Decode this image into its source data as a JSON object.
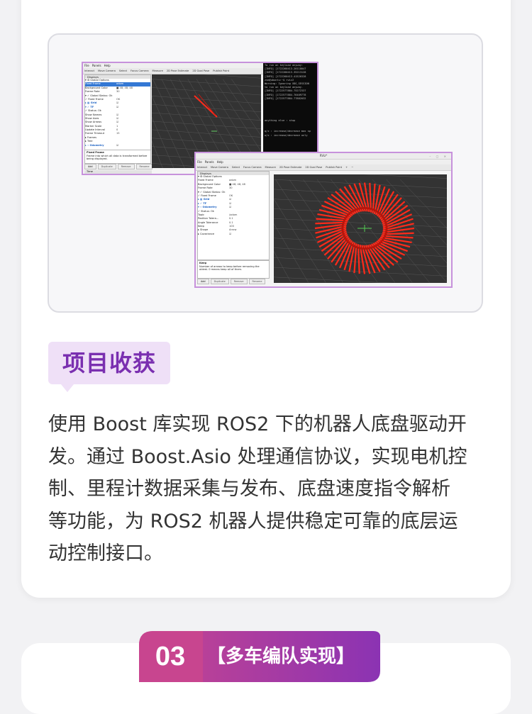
{
  "colors": {
    "page_bg": "#f2f2f4",
    "card_bg": "#ffffff",
    "tag_bg": "#efe0f7",
    "tag_text": "#7a2fb0",
    "badge_left": "#c8458f",
    "badge_right": "#8b33b3",
    "rviz_viewport": "#333333",
    "arrow_red": "#ff2a1a"
  },
  "screenshot": {
    "window1": {
      "menu": [
        "File",
        "Panels",
        "Help"
      ],
      "toolbar": [
        "Interact",
        "Move Camera",
        "Select",
        "Focus Camera",
        "Measure",
        "2D Pose Estimate",
        "2D Goal Pose",
        "Publish Point"
      ],
      "displays_title": "Displays",
      "rows": [
        {
          "k": "▾ ⚙ Global Options",
          "v": ""
        },
        {
          "k": "   Fixed Frame",
          "v": "odom",
          "sel": true
        },
        {
          "k": "   Background Color",
          "v": "■ 48; 48; 48"
        },
        {
          "k": "   Frame Rate",
          "v": "30"
        },
        {
          "k": "▾ ✓ Global Status: Ok",
          "v": ""
        },
        {
          "k": "   ✓ Fixed Frame",
          "v": "OK"
        },
        {
          "k": "▸ ▦ Grid",
          "v": "☑",
          "blue": true
        },
        {
          "k": "▾ ✓ TF",
          "v": "☑",
          "blue": true
        },
        {
          "k": "   ✓ Status: Ok",
          "v": ""
        },
        {
          "k": "   Show Names",
          "v": "☑"
        },
        {
          "k": "   Show Axes",
          "v": "☑"
        },
        {
          "k": "   Show Arrows",
          "v": "☑"
        },
        {
          "k": "   Marker Scale",
          "v": "1"
        },
        {
          "k": "   Update Interval",
          "v": "0"
        },
        {
          "k": "   Frame Timeout",
          "v": "15"
        },
        {
          "k": "▸ Frames",
          "v": ""
        },
        {
          "k": "▸ Tree",
          "v": ""
        },
        {
          "k": "▸ ⌁ Odometry",
          "v": "☑",
          "blue": true
        }
      ],
      "desc_title": "Fixed Frame",
      "desc_text": "Frame into which all data is transformed before being displayed.",
      "buttons": [
        "Add",
        "Duplicate",
        "Remove",
        "Rename"
      ],
      "bottom_label": "Time",
      "terminal_lines": [
        "To run on keyload anyway:",
        "[INFO] [1722260413.20118047",
        "[INFO] [1722260413.35213128",
        "[INFO] [1722260413.41520328",
        "zsm@ubuntu:~$ rviz2",
        "Warning: Ignoring XDG_SESSION",
        " to run on keyload anyway.",
        "[INFO] [1722577884.75272337",
        "[INFO] [1722577884.76409778",
        "[INFO] [1722577884.77882032",
        "",
        "",
        "",
        "",
        "",
        "anything else : stop",
        "",
        "",
        "q/z : increase/decrease max sp",
        "w/x : increase/decrease only"
      ]
    },
    "window2": {
      "title": "RViz*",
      "menu": [
        "File",
        "Panels",
        "Help"
      ],
      "toolbar": [
        "Interact",
        "Move Camera",
        "Select",
        "Focus Camera",
        "Measure",
        "2D Pose Estimate",
        "2D Goal Pose",
        "Publish Point",
        "+",
        "−"
      ],
      "displays_title": "Displays",
      "rows": [
        {
          "k": "▾ ⚙ Global Options",
          "v": ""
        },
        {
          "k": "   Fixed Frame",
          "v": "odom"
        },
        {
          "k": "   Background Color",
          "v": "■ 48; 48; 48"
        },
        {
          "k": "   Frame Rate",
          "v": "30"
        },
        {
          "k": "▾ ✓ Global Status: Ok",
          "v": ""
        },
        {
          "k": "   ✓ Fixed Frame",
          "v": "OK"
        },
        {
          "k": "▸ ▦ Grid",
          "v": "☑",
          "blue": true
        },
        {
          "k": "▸ ✓ TF",
          "v": "☑",
          "blue": true
        },
        {
          "k": "▾ ⌁ Odometry",
          "v": "☑",
          "blue": true
        },
        {
          "k": "   ✓ Status: Ok",
          "v": ""
        },
        {
          "k": "   Topic",
          "v": "/odom"
        },
        {
          "k": "   Position Tolera...",
          "v": "0.1"
        },
        {
          "k": "   Angle Tolerance",
          "v": "0.1"
        },
        {
          "k": "   Keep",
          "v": "100"
        },
        {
          "k": "   ▸ Shape",
          "v": "Arrow"
        },
        {
          "k": "   ▸ Covariance",
          "v": "☑"
        }
      ],
      "desc_title": "Keep",
      "desc_text": "Number of arrows to keep before removing the oldest. 0 means keep all of them.",
      "buttons": [
        "Add",
        "Duplicate",
        "Remove",
        "Rename"
      ],
      "arrow_count": 60
    }
  },
  "harvest": {
    "tag": "项目收获",
    "paragraph_lines": [
      "使用 Boost 库实现 ROS2 下的机器人底盘驱动开",
      "发。通过 Boost.Asio 处理通信协议，实现电机控",
      "制、里程计数据采集与发布、底盘速度指令解析",
      "等功能，为 ROS2 机器人提供稳定可靠的底层运",
      "动控制接口。"
    ]
  },
  "next_section": {
    "number": "03",
    "title": "【多车编队实现】"
  }
}
